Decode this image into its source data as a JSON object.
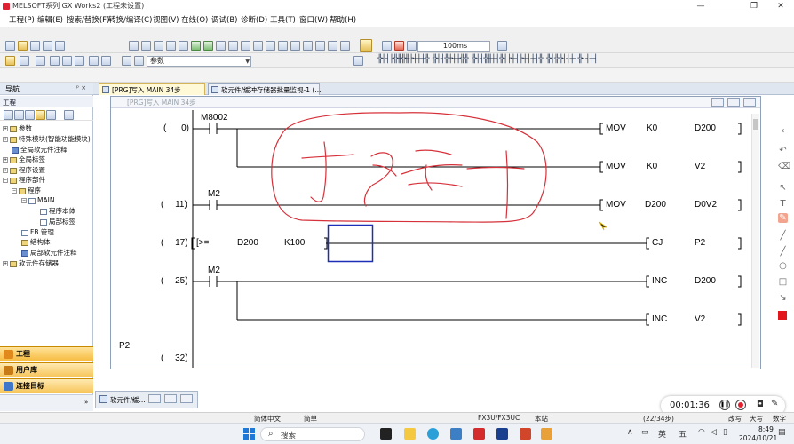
{
  "window": {
    "title": "MELSOFT系列 GX Works2 (工程未设置)",
    "minimize_glyph": "—",
    "restore_glyph": "❐",
    "close_glyph": "✕"
  },
  "menu": [
    "工程(P)",
    "编辑(E)",
    "搜索/替换(F)",
    "转换/编译(C)",
    "视图(V)",
    "在线(O)",
    "调试(B)",
    "诊断(D)",
    "工具(T)",
    "窗口(W)",
    "帮助(H)"
  ],
  "toolbar": {
    "scan_time": "100ms",
    "param_combo": "参数"
  },
  "nav": {
    "title": "导航",
    "pin_glyph": "ᵖ ×",
    "section": "工程",
    "tree": [
      {
        "label": "参数",
        "indent": 0,
        "icon": "folder"
      },
      {
        "label": "特殊模块(智能功能模块)",
        "indent": 0,
        "icon": "folder"
      },
      {
        "label": "全局软元件注释",
        "indent": 0,
        "icon": "doc"
      },
      {
        "label": "全局标签",
        "indent": 0,
        "icon": "folder"
      },
      {
        "label": "程序设置",
        "indent": 0,
        "icon": "folder"
      },
      {
        "label": "程序部件",
        "indent": 0,
        "icon": "folder"
      },
      {
        "label": "程序",
        "indent": 1,
        "icon": "folder"
      },
      {
        "label": "MAIN",
        "indent": 2,
        "icon": "doc"
      },
      {
        "label": "程序本体",
        "indent": 3,
        "icon": "doc"
      },
      {
        "label": "局部标签",
        "indent": 3,
        "icon": "doc"
      },
      {
        "label": "FB 管理",
        "indent": 1,
        "icon": "doc"
      },
      {
        "label": "结构体",
        "indent": 1,
        "icon": "folder"
      },
      {
        "label": "局部软元件注释",
        "indent": 1,
        "icon": "doc"
      },
      {
        "label": "软元件存储器",
        "indent": 0,
        "icon": "folder"
      }
    ],
    "buttons": [
      "工程",
      "用户库",
      "连接目标"
    ]
  },
  "tabs": [
    {
      "label": "[PRG]写入 MAIN 34步",
      "active": true
    },
    {
      "label": "软元件/缓冲存储器批量监视-1 (...",
      "active": false
    }
  ],
  "ladder": {
    "window_title": "[PRG]写入 MAIN 34步",
    "rungs": [
      {
        "step": "0"
      },
      {
        "step": "11"
      },
      {
        "step": "17"
      },
      {
        "step": "25"
      },
      {
        "step": "32"
      }
    ],
    "contacts": {
      "m8002": "M8002",
      "m2_a": "M2",
      "m2_b": "M2"
    },
    "compare": {
      "op": "[>=",
      "a": "D200",
      "b": "K100"
    },
    "label_p2": "P2",
    "instructions": [
      {
        "op": "MOV",
        "arg1": "K0",
        "arg2": "D200"
      },
      {
        "op": "MOV",
        "arg1": "K0",
        "arg2": "V2"
      },
      {
        "op": "MOV",
        "arg1": "D200",
        "arg2": "D0V2"
      },
      {
        "op": "CJ",
        "arg1": "P2",
        "arg2": ""
      },
      {
        "op": "INC",
        "arg1": "D200",
        "arg2": ""
      },
      {
        "op": "INC",
        "arg1": "V2",
        "arg2": ""
      }
    ],
    "annotation_color": "#d6313a"
  },
  "bottom_window": {
    "label": "软元件/缓..."
  },
  "recorder": {
    "time": "00:01:36"
  },
  "status": {
    "lang": "简体中文",
    "mode": "简单",
    "cpu": "FX3U/FX3UC",
    "host": "本站",
    "steps": "(22/34步)",
    "edit": "改写",
    "caps": "大写",
    "num": "数字"
  },
  "taskbar": {
    "search": "搜索",
    "ime": "英",
    "ime2": "五",
    "time": "8:49",
    "date": "2024/10/21"
  }
}
